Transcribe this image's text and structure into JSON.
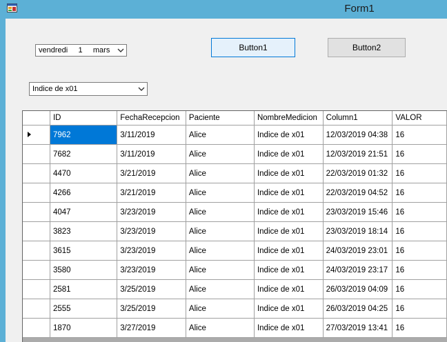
{
  "window": {
    "title": "Form1"
  },
  "datepicker": {
    "value": "vendredi     1     mars"
  },
  "buttons": {
    "button1": "Button1",
    "button2": "Button2"
  },
  "combobox": {
    "value": "Indice de x01"
  },
  "grid": {
    "columns": [
      "ID",
      "FechaRecepcion",
      "Paciente",
      "NombreMedicion",
      "Column1",
      "VALOR"
    ],
    "rows": [
      [
        "7962",
        "3/11/2019",
        "Alice",
        "Indice de x01",
        "12/03/2019 04:38",
        "16"
      ],
      [
        "7682",
        "3/11/2019",
        "Alice",
        "Indice de x01",
        "12/03/2019 21:51",
        "16"
      ],
      [
        "4470",
        "3/21/2019",
        "Alice",
        "Indice de x01",
        "22/03/2019 01:32",
        "16"
      ],
      [
        "4266",
        "3/21/2019",
        "Alice",
        "Indice de x01",
        "22/03/2019 04:52",
        "16"
      ],
      [
        "4047",
        "3/23/2019",
        "Alice",
        "Indice de x01",
        "23/03/2019 15:46",
        "16"
      ],
      [
        "3823",
        "3/23/2019",
        "Alice",
        "Indice de x01",
        "23/03/2019 18:14",
        "16"
      ],
      [
        "3615",
        "3/23/2019",
        "Alice",
        "Indice de x01",
        "24/03/2019 23:01",
        "16"
      ],
      [
        "3580",
        "3/23/2019",
        "Alice",
        "Indice de x01",
        "24/03/2019 23:17",
        "16"
      ],
      [
        "2581",
        "3/25/2019",
        "Alice",
        "Indice de x01",
        "26/03/2019 04:09",
        "16"
      ],
      [
        "2555",
        "3/25/2019",
        "Alice",
        "Indice de x01",
        "26/03/2019 04:25",
        "16"
      ],
      [
        "1870",
        "3/27/2019",
        "Alice",
        "Indice de x01",
        "27/03/2019 13:41",
        "16"
      ]
    ]
  }
}
